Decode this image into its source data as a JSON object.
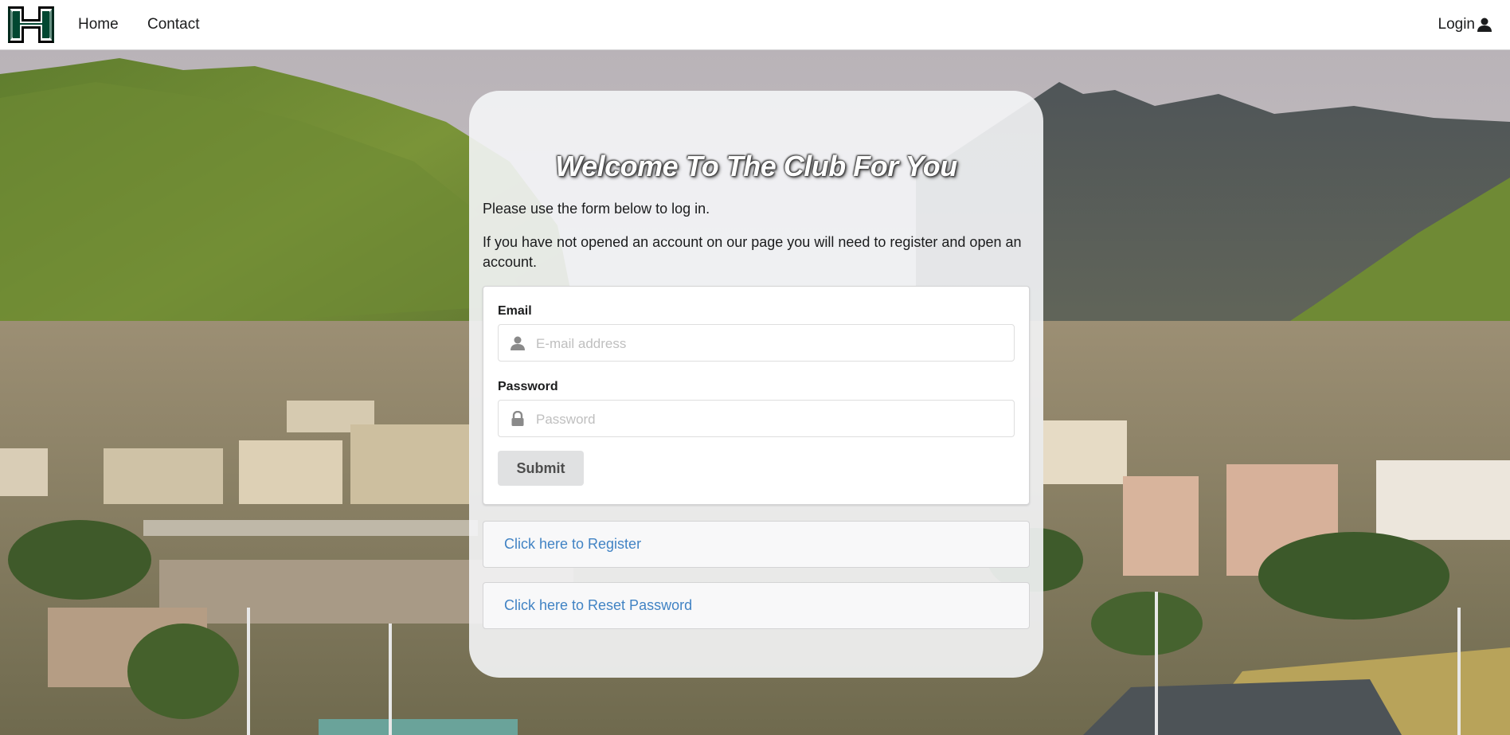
{
  "nav": {
    "home_label": "Home",
    "contact_label": "Contact",
    "login_label": "Login",
    "logo_icon": "uh-h-logo-icon",
    "login_icon": "user-icon"
  },
  "card": {
    "title": "Welcome To The Club For You",
    "intro_line_1": "Please use the form below to log in.",
    "intro_line_2": "If you have not opened an account on our page you will need to register and open an account."
  },
  "form": {
    "email_label": "Email",
    "email_placeholder": "E-mail address",
    "email_value": "",
    "email_icon": "user-icon",
    "password_label": "Password",
    "password_placeholder": "Password",
    "password_value": "",
    "password_icon": "lock-icon",
    "submit_label": "Submit"
  },
  "links": {
    "register_label": "Click here to Register",
    "reset_label": "Click here to Reset Password"
  },
  "colors": {
    "logo_green": "#024731",
    "link_blue": "#4183c4",
    "button_grey": "#e0e1e2"
  }
}
